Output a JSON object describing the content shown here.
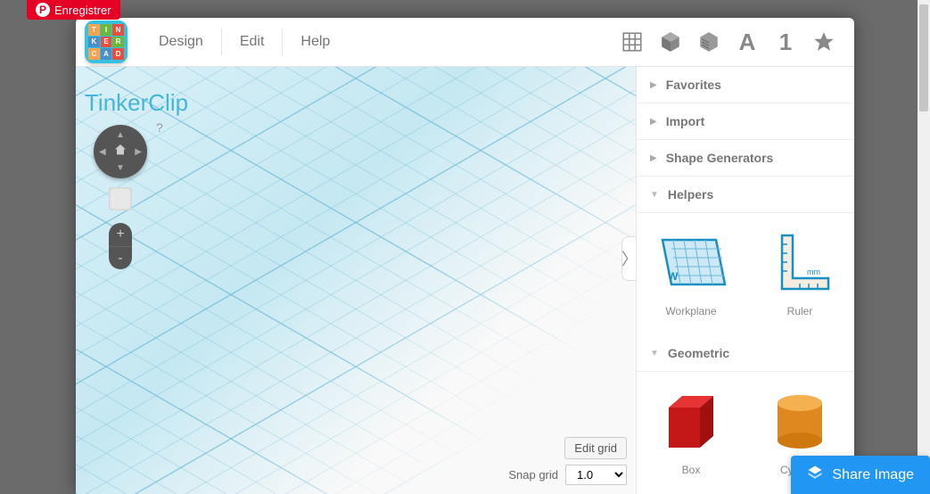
{
  "pinterest": {
    "label": "Enregistrer"
  },
  "logo_chars": [
    "T",
    "I",
    "N",
    "K",
    "E",
    "R",
    "C",
    "A",
    "D"
  ],
  "menu": {
    "design": "Design",
    "edit": "Edit",
    "help": "Help"
  },
  "document": {
    "title": "TinkerClip"
  },
  "zoom": {
    "in": "+",
    "out": "-"
  },
  "grid": {
    "edit_label": "Edit grid",
    "snap_label": "Snap grid",
    "snap_value": "1.0"
  },
  "sections": {
    "favorites": "Favorites",
    "import": "Import",
    "generators": "Shape Generators",
    "helpers": "Helpers",
    "geometric": "Geometric"
  },
  "helpers": {
    "workplane": {
      "label": "Workplane",
      "badge": "W"
    },
    "ruler": {
      "label": "Ruler",
      "unit": "mm"
    }
  },
  "geometric": {
    "box": "Box",
    "cylinder": "Cylinder"
  },
  "share": {
    "label": "Share Image"
  },
  "help_hint": "?",
  "expand_glyph": "〉"
}
